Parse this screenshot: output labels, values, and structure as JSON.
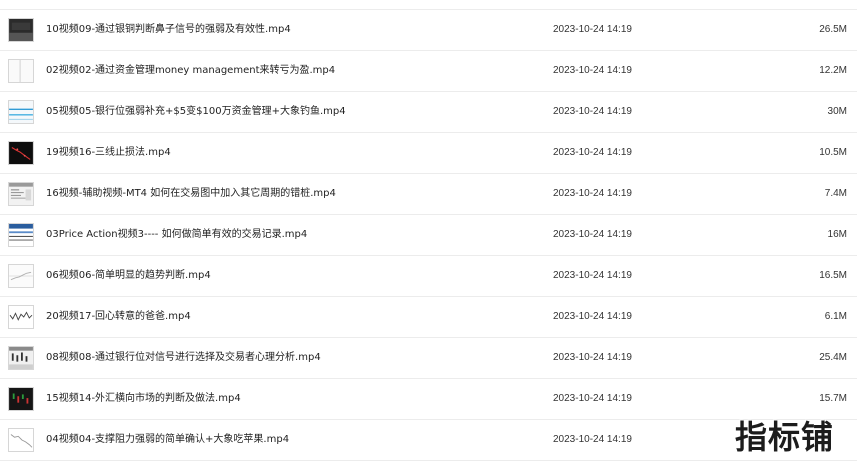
{
  "files": [
    {
      "name": "10视频09-通过银铜判断鼻子信号的强弱及有效性.mp4",
      "date": "2023-10-24 14:19",
      "size": "26.5M",
      "thumb": "dark-video-thumbnail"
    },
    {
      "name": "02视频02-通过资金管理money management来转亏为盈.mp4",
      "date": "2023-10-24 14:19",
      "size": "12.2M",
      "thumb": "blank-video-thumbnail"
    },
    {
      "name": "05视频05-银行位强弱补充+$5变$100万资金管理+大象钓鱼.mp4",
      "date": "2023-10-24 14:19",
      "size": "30M",
      "thumb": "chart-video-thumbnail"
    },
    {
      "name": "19视频16-三线止损法.mp4",
      "date": "2023-10-24 14:19",
      "size": "10.5M",
      "thumb": "dark-chart-thumbnail"
    },
    {
      "name": "16视频-辅助视频-MT4 如何在交易图中加入其它周期的错桩.mp4",
      "date": "2023-10-24 14:19",
      "size": "7.4M",
      "thumb": "platform-video-thumbnail"
    },
    {
      "name": "03Price Action视频3---- 如何做简单有效的交易记录.mp4",
      "date": "2023-10-24 14:19",
      "size": "16M",
      "thumb": "platform-video-thumbnail"
    },
    {
      "name": "06视频06-简单明显的趋势判断.mp4",
      "date": "2023-10-24 14:19",
      "size": "16.5M",
      "thumb": "chart-video-thumbnail"
    },
    {
      "name": "20视频17-回心转意的爸爸.mp4",
      "date": "2023-10-24 14:19",
      "size": "6.1M",
      "thumb": "candlestick-video-thumbnail"
    },
    {
      "name": "08视频08-通过银行位对信号进行选择及交易者心理分析.mp4",
      "date": "2023-10-24 14:19",
      "size": "25.4M",
      "thumb": "platform-video-thumbnail"
    },
    {
      "name": "15视频14-外汇横向市场的判断及做法.mp4",
      "date": "2023-10-24 14:19",
      "size": "15.7M",
      "thumb": "dark-chart-thumbnail"
    },
    {
      "name": "04视频04-支撑阻力强弱的简单确认+大象吃苹果.mp4",
      "date": "2023-10-24 14:19",
      "size": "",
      "thumb": "candlestick-video-thumbnail"
    }
  ],
  "watermark": "指标铺"
}
